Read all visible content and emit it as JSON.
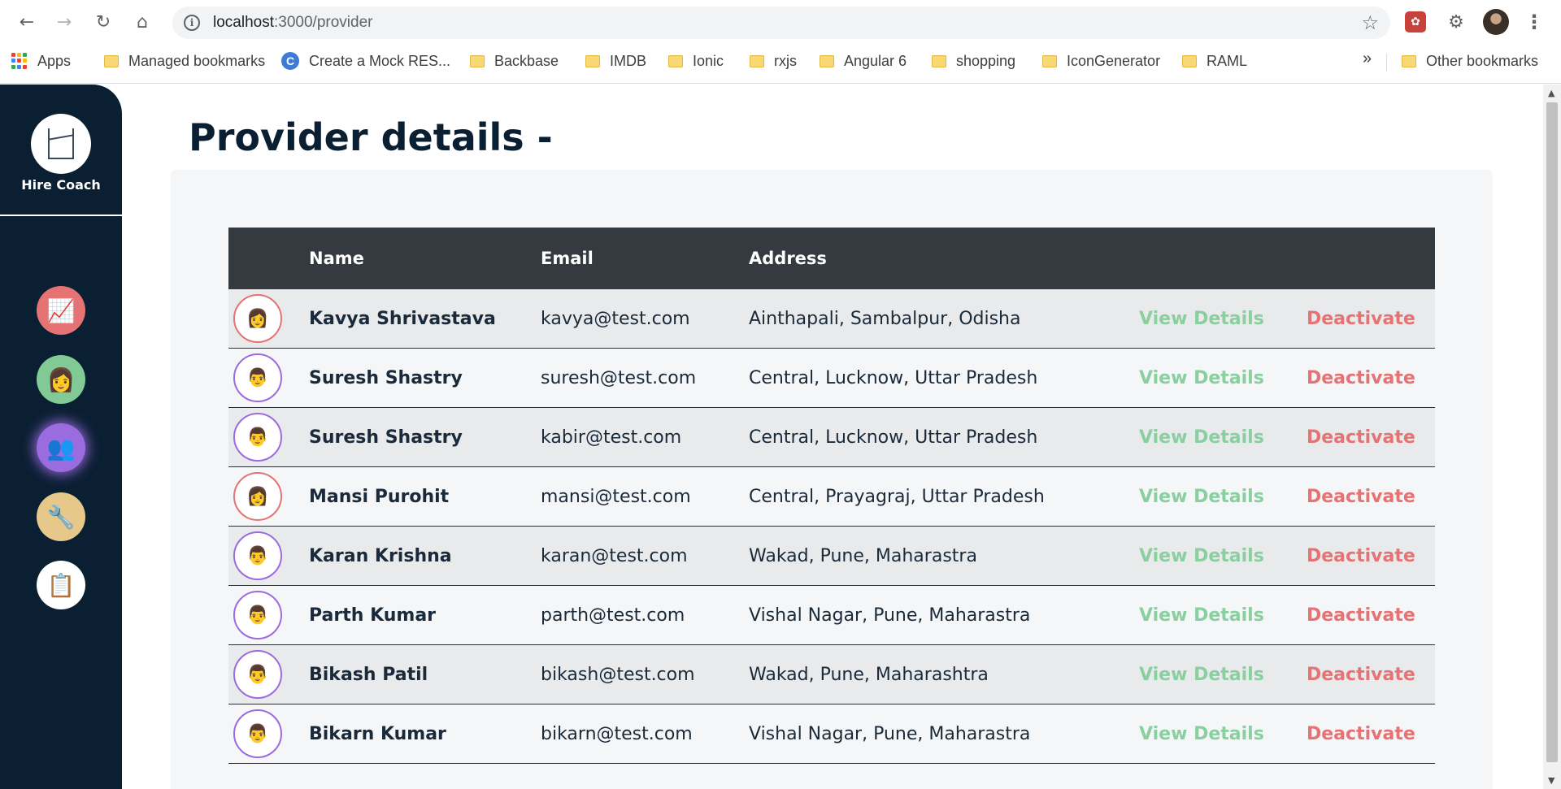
{
  "browser": {
    "url_host": "localhost",
    "url_path": ":3000/provider",
    "icons": {
      "back": "arrow-left-icon",
      "forward": "arrow-right-icon",
      "reload": "reload-icon",
      "home": "home-icon",
      "info": "info-icon",
      "star": "star-icon",
      "extensions": "puzzle-icon",
      "menu": "kebab-menu-icon"
    },
    "bookmarks": [
      {
        "label": "Apps",
        "type": "apps"
      },
      {
        "label": "Managed bookmarks",
        "type": "folder"
      },
      {
        "label": "Create a Mock RES...",
        "type": "site"
      },
      {
        "label": "Backbase",
        "type": "folder"
      },
      {
        "label": "IMDB",
        "type": "folder"
      },
      {
        "label": "Ionic",
        "type": "folder"
      },
      {
        "label": "rxjs",
        "type": "folder"
      },
      {
        "label": "Angular 6",
        "type": "folder"
      },
      {
        "label": "shopping",
        "type": "folder"
      },
      {
        "label": "IconGenerator",
        "type": "folder"
      },
      {
        "label": "RAML",
        "type": "folder"
      }
    ],
    "more_label": "»",
    "other_bookmarks": "Other bookmarks"
  },
  "sidebar": {
    "brand": "Hire Coach",
    "nav": [
      {
        "icon": "presentation-icon"
      },
      {
        "icon": "coach-icon"
      },
      {
        "icon": "providers-icon",
        "active": true
      },
      {
        "icon": "tools-icon"
      },
      {
        "icon": "dashboard-icon"
      }
    ]
  },
  "main": {
    "title": "Provider details -",
    "table": {
      "headers": {
        "name": "Name",
        "email": "Email",
        "address": "Address"
      },
      "view_label": "View Details",
      "deactivate_label": "Deactivate",
      "rows": [
        {
          "name": "Kavya Shrivastava",
          "email": "kavya@test.com",
          "address": "Ainthapali, Sambalpur, Odisha",
          "gender": "f"
        },
        {
          "name": "Suresh Shastry",
          "email": "suresh@test.com",
          "address": "Central, Lucknow, Uttar Pradesh",
          "gender": "m"
        },
        {
          "name": "Suresh Shastry",
          "email": "kabir@test.com",
          "address": "Central, Lucknow, Uttar Pradesh",
          "gender": "m"
        },
        {
          "name": "Mansi Purohit",
          "email": "mansi@test.com",
          "address": "Central, Prayagraj, Uttar Pradesh",
          "gender": "f"
        },
        {
          "name": "Karan Krishna",
          "email": "karan@test.com",
          "address": "Wakad, Pune, Maharastra",
          "gender": "m"
        },
        {
          "name": "Parth Kumar",
          "email": "parth@test.com",
          "address": "Vishal Nagar, Pune, Maharastra",
          "gender": "m"
        },
        {
          "name": "Bikash Patil",
          "email": "bikash@test.com",
          "address": "Wakad, Pune, Maharashtra",
          "gender": "m"
        },
        {
          "name": "Bikarn Kumar",
          "email": "bikarn@test.com",
          "address": "Vishal Nagar, Pune, Maharastra",
          "gender": "m"
        }
      ]
    }
  },
  "colors": {
    "sidebar_bg": "#0b1f33",
    "header_bg": "#343a40",
    "view_link": "#89cfa0",
    "deactivate_link": "#e57373",
    "active_nav": "#9b6be0"
  }
}
